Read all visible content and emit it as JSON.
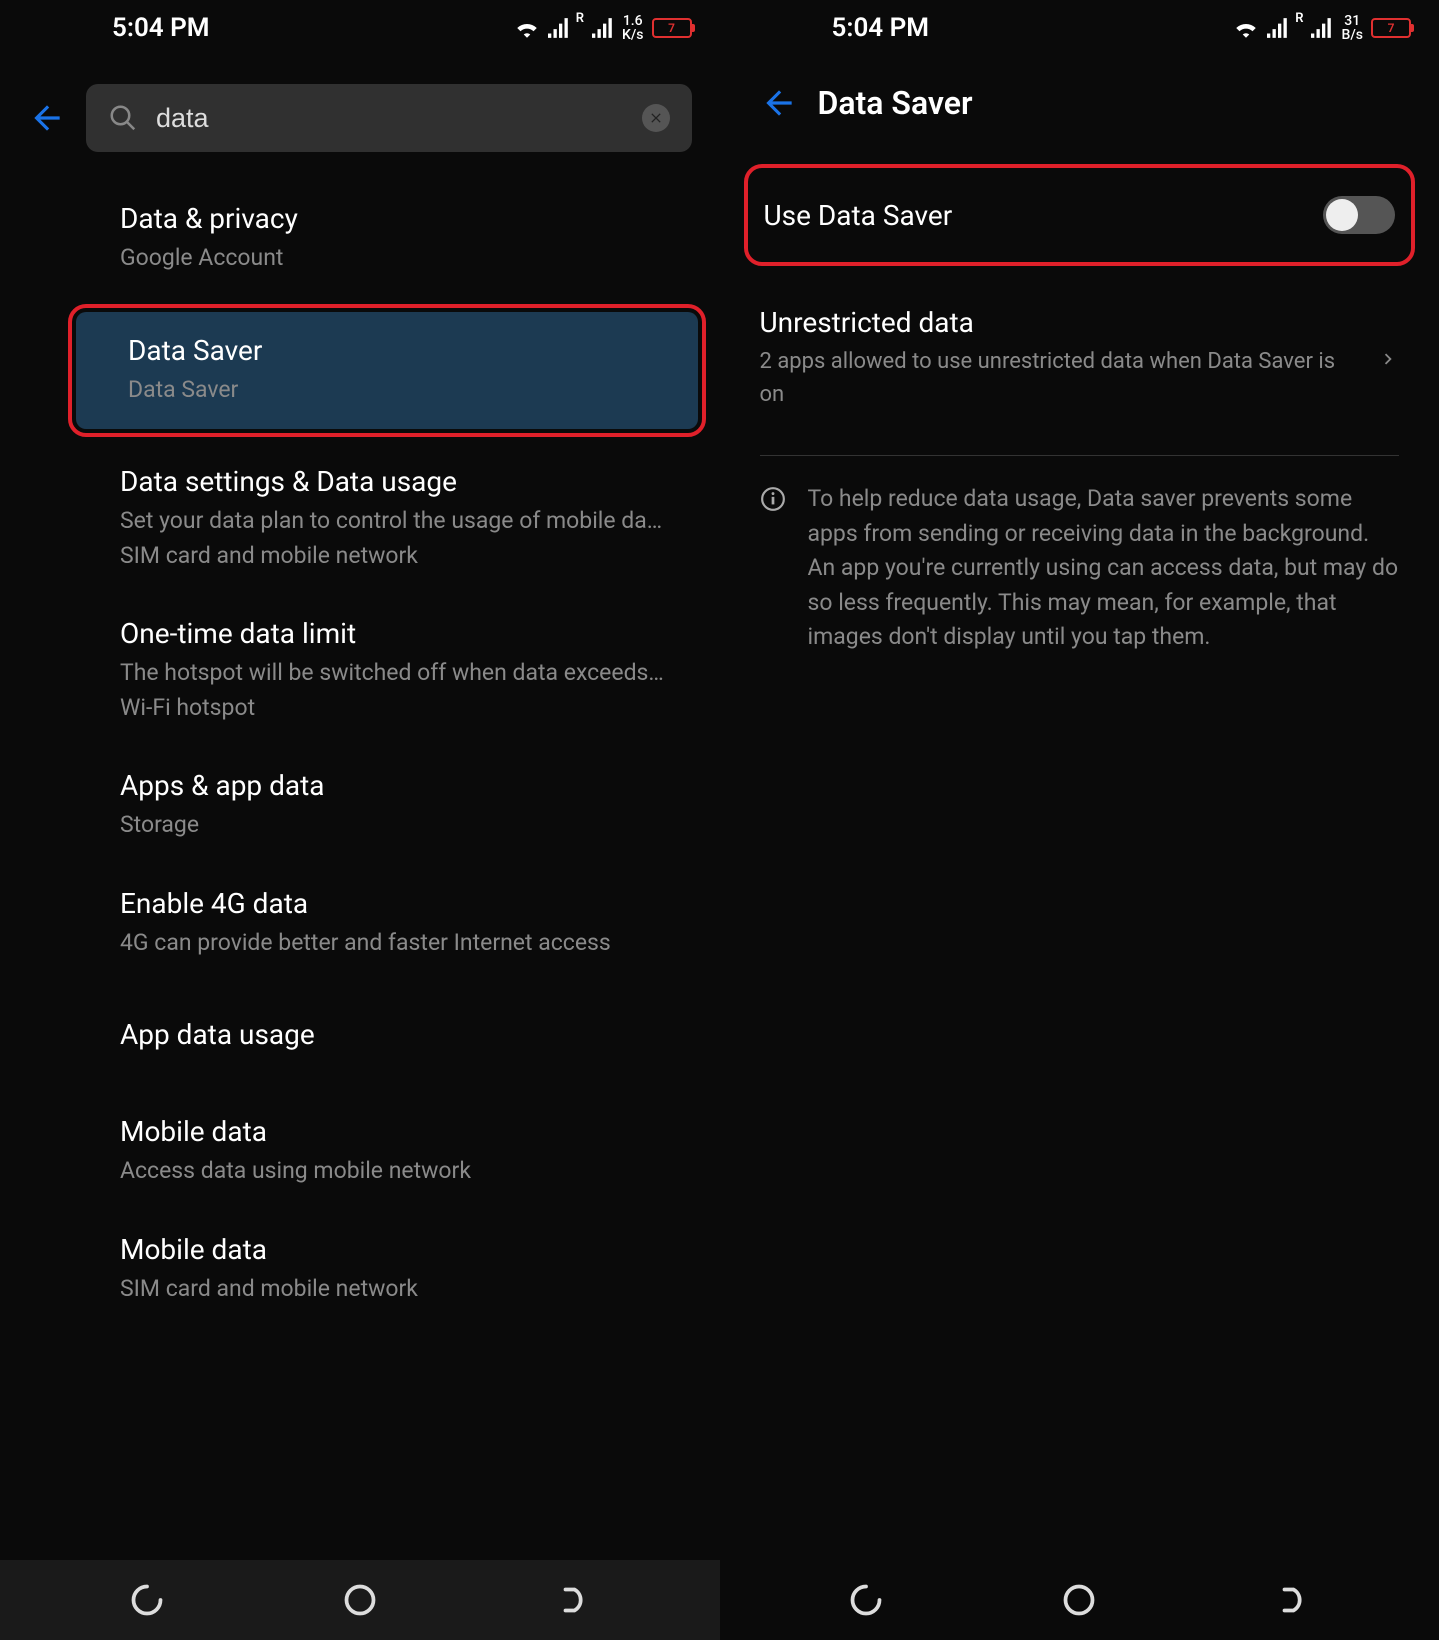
{
  "status_bar": {
    "time": "5:04 PM",
    "left_speed_top": "1.6",
    "left_speed_bottom": "K/s",
    "right_speed_top": "31",
    "right_speed_bottom": "B/s",
    "roaming": "R",
    "battery_level": "7"
  },
  "left": {
    "search_value": "data",
    "items": [
      {
        "title": "Data & privacy",
        "sub": "Google Account"
      },
      {
        "title": "Data Saver",
        "sub": "Data Saver",
        "highlighted": true
      },
      {
        "title": "Data settings & Data usage",
        "sub": "Set your data plan to control the usage of mobile da…\nSIM card and mobile network"
      },
      {
        "title": "One-time data limit",
        "sub": "The hotspot will be switched off when data exceeds…\nWi-Fi hotspot"
      },
      {
        "title": "Apps & app data",
        "sub": "Storage"
      },
      {
        "title": "Enable 4G data",
        "sub": "4G can provide better and faster Internet access"
      },
      {
        "title": "App data usage",
        "sub": ""
      },
      {
        "title": "Mobile data",
        "sub": "Access data using mobile network"
      },
      {
        "title": "Mobile data",
        "sub": "SIM card and mobile network"
      }
    ]
  },
  "right": {
    "page_title": "Data Saver",
    "toggle_label": "Use Data Saver",
    "toggle_on": false,
    "unrestricted_title": "Unrestricted data",
    "unrestricted_sub": "2 apps allowed to use unrestricted data when Data Saver is on",
    "info_text": "To help reduce data usage, Data saver prevents some apps from sending or receiving data in the background. An app you're currently using can access data, but may do so less frequently. This may mean, for example, that images don't display until you tap them."
  }
}
